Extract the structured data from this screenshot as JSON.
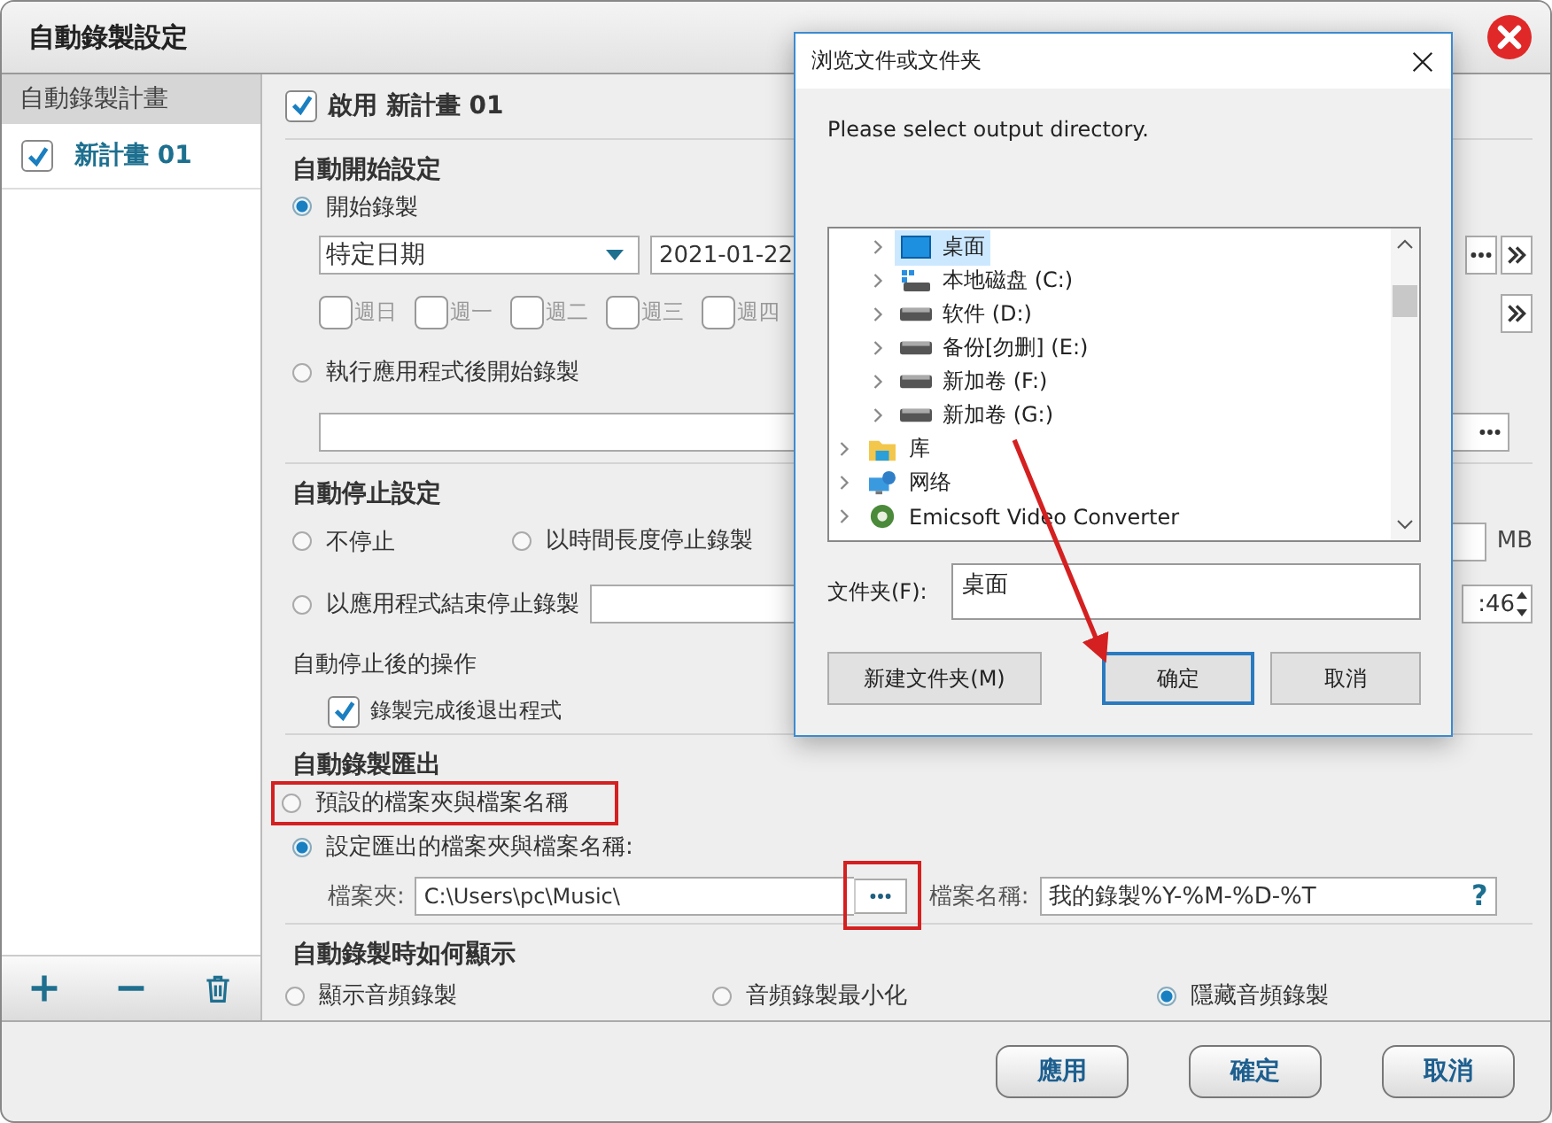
{
  "window": {
    "title": "自動錄製設定"
  },
  "sidebar": {
    "header": "自動錄製計畫",
    "items": [
      {
        "label": "新計畫 01",
        "checked": true
      }
    ]
  },
  "enable": {
    "label": "啟用 新計畫 01",
    "checked": true
  },
  "auto_start": {
    "title": "自動開始設定",
    "options": [
      {
        "label": "開始錄製",
        "selected": true
      },
      {
        "label": "執行應用程式後開始錄製",
        "selected": false
      }
    ],
    "schedule": "特定日期",
    "date": "2021-01-22",
    "weekdays": [
      {
        "label": "週日",
        "checked": false
      },
      {
        "label": "週一",
        "checked": false
      },
      {
        "label": "週二",
        "checked": false
      },
      {
        "label": "週三",
        "checked": false
      },
      {
        "label": "週四",
        "checked": false
      }
    ]
  },
  "auto_stop": {
    "title": "自動停止設定",
    "options": [
      {
        "label": "不停止",
        "selected": false
      },
      {
        "label": "以時間長度停止錄製",
        "selected": false
      },
      {
        "label": "以應用程式結束停止錄製",
        "selected": false
      }
    ],
    "size_unit": "MB",
    "time_value": ":46",
    "after_title": "自動停止後的操作",
    "exit_option": {
      "label": "錄製完成後退出程式",
      "checked": true
    }
  },
  "export": {
    "title": "自動錄製匯出",
    "options": [
      {
        "label": "預設的檔案夾與檔案名稱",
        "selected": false
      },
      {
        "label": "設定匯出的檔案夾與檔案名稱:",
        "selected": true
      }
    ],
    "folder_label": "檔案夾:",
    "folder": "C:\\Users\\pc\\Music\\",
    "filename_label": "檔案名稱:",
    "filename": "我的錄製%Y-%M-%D-%T",
    "help": "?"
  },
  "display": {
    "title": "自動錄製時如何顯示",
    "options": [
      {
        "label": "顯示音頻錄製",
        "selected": false
      },
      {
        "label": "音頻錄製最小化",
        "selected": false
      },
      {
        "label": "隱藏音頻錄製",
        "selected": true
      }
    ]
  },
  "buttons": [
    "應用",
    "確定",
    "取消"
  ],
  "dialog": {
    "title": "浏览文件或文件夹",
    "prompt": "Please select output directory.",
    "tree": {
      "indented": [
        {
          "label": "桌面",
          "kind": "desktop",
          "selected": true
        },
        {
          "label": "本地磁盘 (C:)",
          "kind": "system-drive",
          "selected": false
        },
        {
          "label": "软件 (D:)",
          "kind": "drive",
          "selected": false
        },
        {
          "label": "备份[勿删] (E:)",
          "kind": "drive",
          "selected": false
        },
        {
          "label": "新加卷 (F:)",
          "kind": "drive",
          "selected": false
        },
        {
          "label": "新加卷 (G:)",
          "kind": "drive",
          "selected": false
        }
      ],
      "items": [
        {
          "label": "库",
          "kind": "library",
          "selected": false
        },
        {
          "label": "网络",
          "kind": "network",
          "selected": false
        },
        {
          "label": "Emicsoft Video Converter",
          "kind": "app",
          "selected": false
        }
      ]
    },
    "folder_label": "文件夹(F):",
    "folder": "桌面",
    "buttons": [
      {
        "label": "新建文件夹(M)",
        "focused": false
      },
      {
        "label": "确定",
        "focused": true
      },
      {
        "label": "取消",
        "focused": false
      }
    ]
  }
}
